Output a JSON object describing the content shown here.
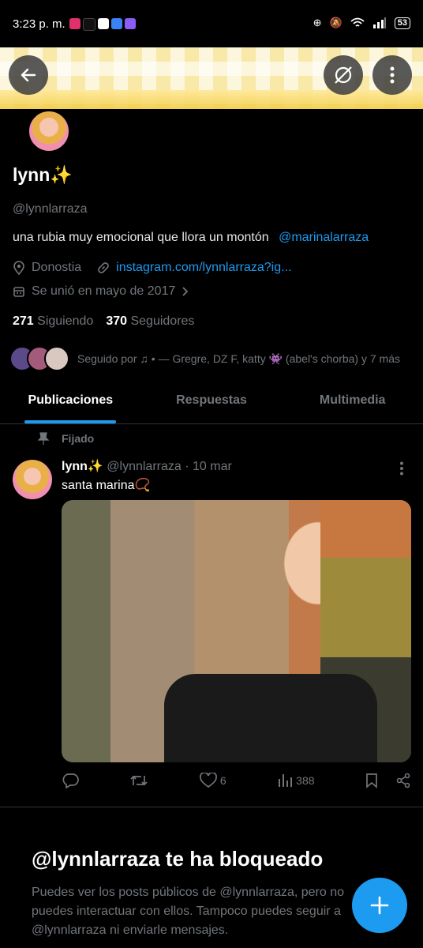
{
  "status_bar": {
    "time": "3:23 p. m.",
    "battery": "53"
  },
  "profile": {
    "name": "lynn✨",
    "handle": "@lynnlarraza",
    "bio_text": "una rubia muy emocional que llora un montón",
    "bio_mention": "@marinalarraza",
    "location": "Donostia",
    "website": "instagram.com/lynnlarraza?ig...",
    "joined": "Se unió en mayo de 2017",
    "following_count": "271",
    "following_label": "Siguiendo",
    "followers_count": "370",
    "followers_label": "Seguidores",
    "followed_by": "Seguido por ♫ • — Gregre, DZ F, katty 👾 (abel's chorba) y 7 más"
  },
  "tabs": [
    {
      "label": "Publicaciones"
    },
    {
      "label": "Respuestas"
    },
    {
      "label": "Multimedia"
    }
  ],
  "post": {
    "pinned_label": "Fijado",
    "author_name": "lynn✨",
    "author_handle": "@lynnlarraza",
    "date": "· 10 mar",
    "text": "santa marina📿",
    "likes": "6",
    "views": "388"
  },
  "blocked": {
    "title": "@lynnlarraza te ha bloqueado",
    "text": "Puedes ver los posts públicos de @lynnlarraza, pero no puedes interactuar con ellos. Tampoco puedes seguir a @lynnlarraza ni enviarle mensajes."
  },
  "colors": {
    "accent": "#1d9bf0",
    "muted": "#71767b",
    "background": "#000000"
  }
}
